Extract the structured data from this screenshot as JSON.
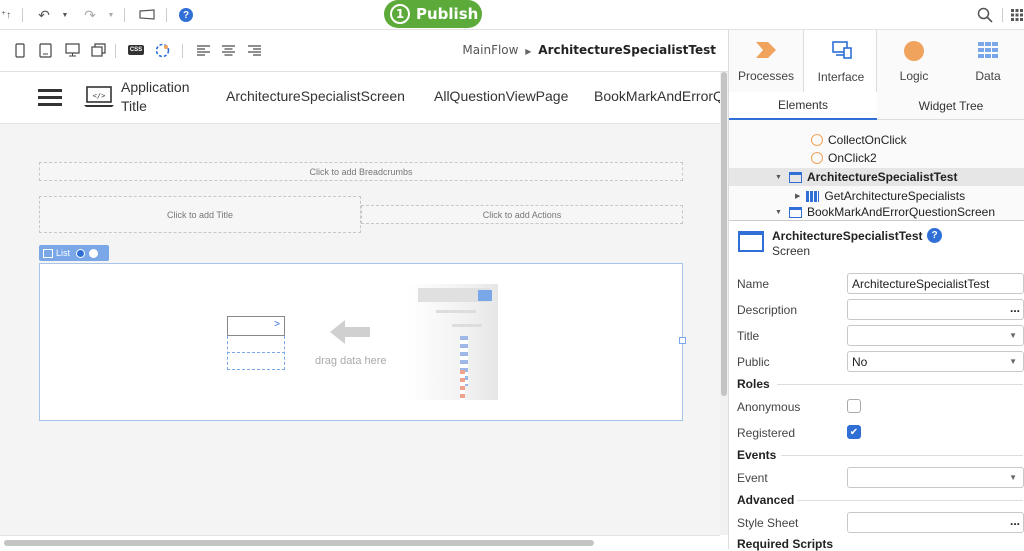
{
  "topbar": {
    "publish_number": "1",
    "publish_label": "Publish",
    "help_glyph": "?"
  },
  "canvas_toolbar": {
    "css_label": "CSS",
    "path_flow": "MainFlow",
    "path_screen": "ArchitectureSpecialistTest"
  },
  "app_header": {
    "app_title": "Application Title",
    "nav_items": [
      "ArchitectureSpecialistScreen",
      "AllQuestionViewPage",
      "BookMarkAndErrorQ"
    ]
  },
  "canvas": {
    "breadcrumbs_placeholder": "Click to add Breadcrumbs",
    "title_placeholder": "Click to add Title",
    "actions_placeholder": "Click to add Actions",
    "list_tag": "List",
    "drag_hint": "drag data here"
  },
  "right_panel": {
    "tabs": [
      {
        "label": "Processes",
        "icon": "processes-icon"
      },
      {
        "label": "Interface",
        "icon": "interface-icon"
      },
      {
        "label": "Logic",
        "icon": "logic-icon"
      },
      {
        "label": "Data",
        "icon": "data-icon"
      }
    ],
    "active_tab": "Interface",
    "subtabs": [
      "Elements",
      "Widget Tree"
    ],
    "tree": [
      {
        "label": "CollectOnClick"
      },
      {
        "label": "OnClick2"
      },
      {
        "label": "ArchitectureSpecialistTest"
      },
      {
        "label": "GetArchitectureSpecialists"
      },
      {
        "label": "BookMarkAndErrorQuestionScreen"
      }
    ],
    "selected": {
      "name": "ArchitectureSpecialistTest",
      "type": "Screen"
    },
    "properties": {
      "name_label": "Name",
      "name_value": "ArchitectureSpecialistTest",
      "description_label": "Description",
      "description_value": "...",
      "title_label": "Title",
      "public_label": "Public",
      "public_value": "No",
      "roles_header": "Roles",
      "anonymous_label": "Anonymous",
      "anonymous_checked": false,
      "registered_label": "Registered",
      "registered_checked": true,
      "events_header": "Events",
      "event_label": "Event",
      "advanced_header": "Advanced",
      "stylesheet_label": "Style Sheet",
      "stylesheet_value": "...",
      "required_scripts_header": "Required Scripts"
    },
    "colors": {
      "accent": "#2f6fd6",
      "publish": "#5cab3a",
      "processes": "#f0a35c",
      "logic": "#f0a35c"
    }
  }
}
